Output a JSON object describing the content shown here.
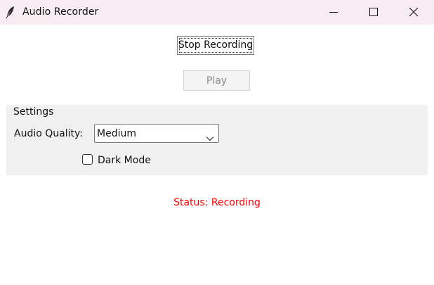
{
  "window": {
    "title": "Audio Recorder",
    "app_icon": "feather-icon",
    "controls": [
      "minimize-icon",
      "maximize-icon",
      "close-icon"
    ]
  },
  "buttons": {
    "stop_recording": "Stop Recording",
    "play": "Play"
  },
  "settings": {
    "group_label": "Settings",
    "audio_quality_label": "Audio Quality:",
    "audio_quality_value": "Medium",
    "dark_mode_label": "Dark Mode",
    "dark_mode_checked": false
  },
  "status": {
    "text": "Status: Recording",
    "color": "#ff0000"
  },
  "colors": {
    "titlebar": "#f7ecf1",
    "settings_background": "#f0f0f0"
  }
}
